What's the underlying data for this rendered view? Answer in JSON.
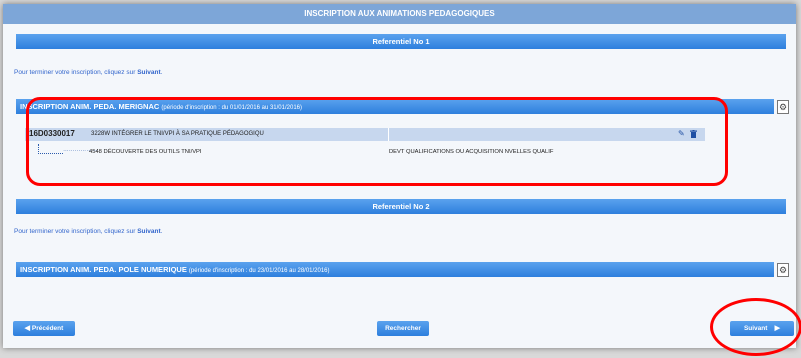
{
  "page": {
    "title": "INSCRIPTION AUX ANIMATIONS PEDAGOGIQUES"
  },
  "referentiel1": {
    "header": "Referentiel No 1",
    "info_prefix": "Pour terminer votre inscription, cliquez sur ",
    "info_link": "Suivant",
    "info_suffix": ".",
    "section": {
      "title": "INSCRIPTION ANIM. PEDA. MERIGNAC",
      "period": "(période d'inscription : du 01/01/2016 au 31/01/2016)",
      "code": "16D0330017",
      "module": "3228W INTÉGRER LE TNI/VPI À SA PRATIQUE PÉDAGOGIQU",
      "sub_dots": "………………",
      "sub_item": "4548 DÉCOUVERTE DES OUTILS TNI/VPI",
      "sub_category": "DEVT QUALIFICATIONS OU ACQUISITION NVELLES QUALIF"
    }
  },
  "referentiel2": {
    "header": "Referentiel No 2",
    "info_prefix": "Pour terminer votre inscription, cliquez sur ",
    "info_link": "Suivant",
    "info_suffix": ".",
    "section": {
      "title": "INSCRIPTION ANIM. PEDA. POLE NUMERIQUE",
      "period": "(période d'inscription : du 23/01/2016 au 28/01/2016)"
    }
  },
  "buttons": {
    "previous": "Précédent",
    "search": "Rechercher",
    "next": "Suivant"
  },
  "colors": {
    "accent": "#2d7fdd",
    "annotation": "#ff0000"
  }
}
